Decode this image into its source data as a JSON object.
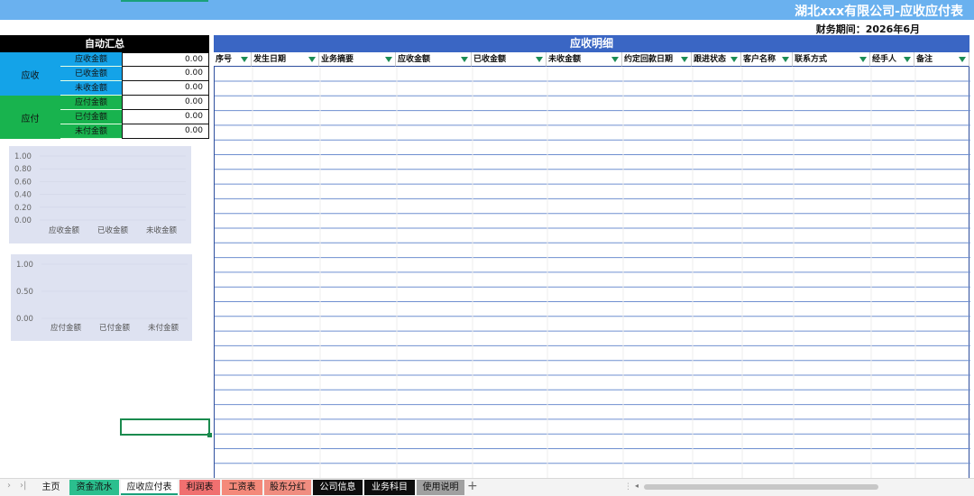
{
  "title": "湖北xxx有限公司-应收应付表",
  "period_label": "财务期间：",
  "period_value": "2026年6月",
  "summary": {
    "header": "自动汇总",
    "receivable": {
      "label": "应收",
      "color": "#14a3e8",
      "rows": [
        {
          "label": "应收金额",
          "value": "0.00"
        },
        {
          "label": "已收金额",
          "value": "0.00"
        },
        {
          "label": "未收金额",
          "value": "0.00"
        }
      ]
    },
    "payable": {
      "label": "应付",
      "color": "#18b34e",
      "rows": [
        {
          "label": "应付金额",
          "value": "0.00"
        },
        {
          "label": "已付金额",
          "value": "0.00"
        },
        {
          "label": "未付金额",
          "value": "0.00"
        }
      ]
    }
  },
  "chart_data": [
    {
      "type": "bar",
      "categories": [
        "应收金额",
        "已收金额",
        "未收金额"
      ],
      "values": [
        0,
        0,
        0
      ],
      "ylim": [
        0,
        1
      ],
      "yticks": [
        "0.00",
        "0.20",
        "0.40",
        "0.60",
        "0.80",
        "1.00"
      ],
      "grid": true
    },
    {
      "type": "bar",
      "categories": [
        "应付金额",
        "已付金额",
        "未付金额"
      ],
      "values": [
        0,
        0,
        0
      ],
      "ylim": [
        0,
        1
      ],
      "yticks": [
        "0.00",
        "0.50",
        "1.00"
      ],
      "grid": true
    }
  ],
  "detail": {
    "title": "应收明细",
    "columns": [
      "序号",
      "发生日期",
      "业务摘要",
      "应收金额",
      "已收金额",
      "未收金额",
      "约定回款日期",
      "跟进状态",
      "客户名称",
      "联系方式",
      "经手人",
      "备注"
    ],
    "rows": []
  },
  "sheet_tabs": [
    {
      "label": "主页",
      "color": "#f3f3f3",
      "text_color": "#111111"
    },
    {
      "label": "资金流水",
      "color": "#2bbf8e",
      "text_color": "#111111"
    },
    {
      "label": "应收应付表",
      "color": "#ffffff",
      "text_color": "#111111",
      "active": true
    },
    {
      "label": "利润表",
      "color": "#f07070",
      "text_color": "#111111"
    },
    {
      "label": "工资表",
      "color": "#f4897a",
      "text_color": "#111111"
    },
    {
      "label": "股东分红",
      "color": "#f08d80",
      "text_color": "#111111"
    },
    {
      "label": "公司信息",
      "color": "#0d0d0d",
      "text_color": "#ffffff"
    },
    {
      "label": "业务科目",
      "color": "#0d0d0d",
      "text_color": "#ffffff"
    },
    {
      "label": "使用说明",
      "color": "#a0a0a0",
      "text_color": "#111111"
    }
  ],
  "add_tab_icon": "plus-icon"
}
